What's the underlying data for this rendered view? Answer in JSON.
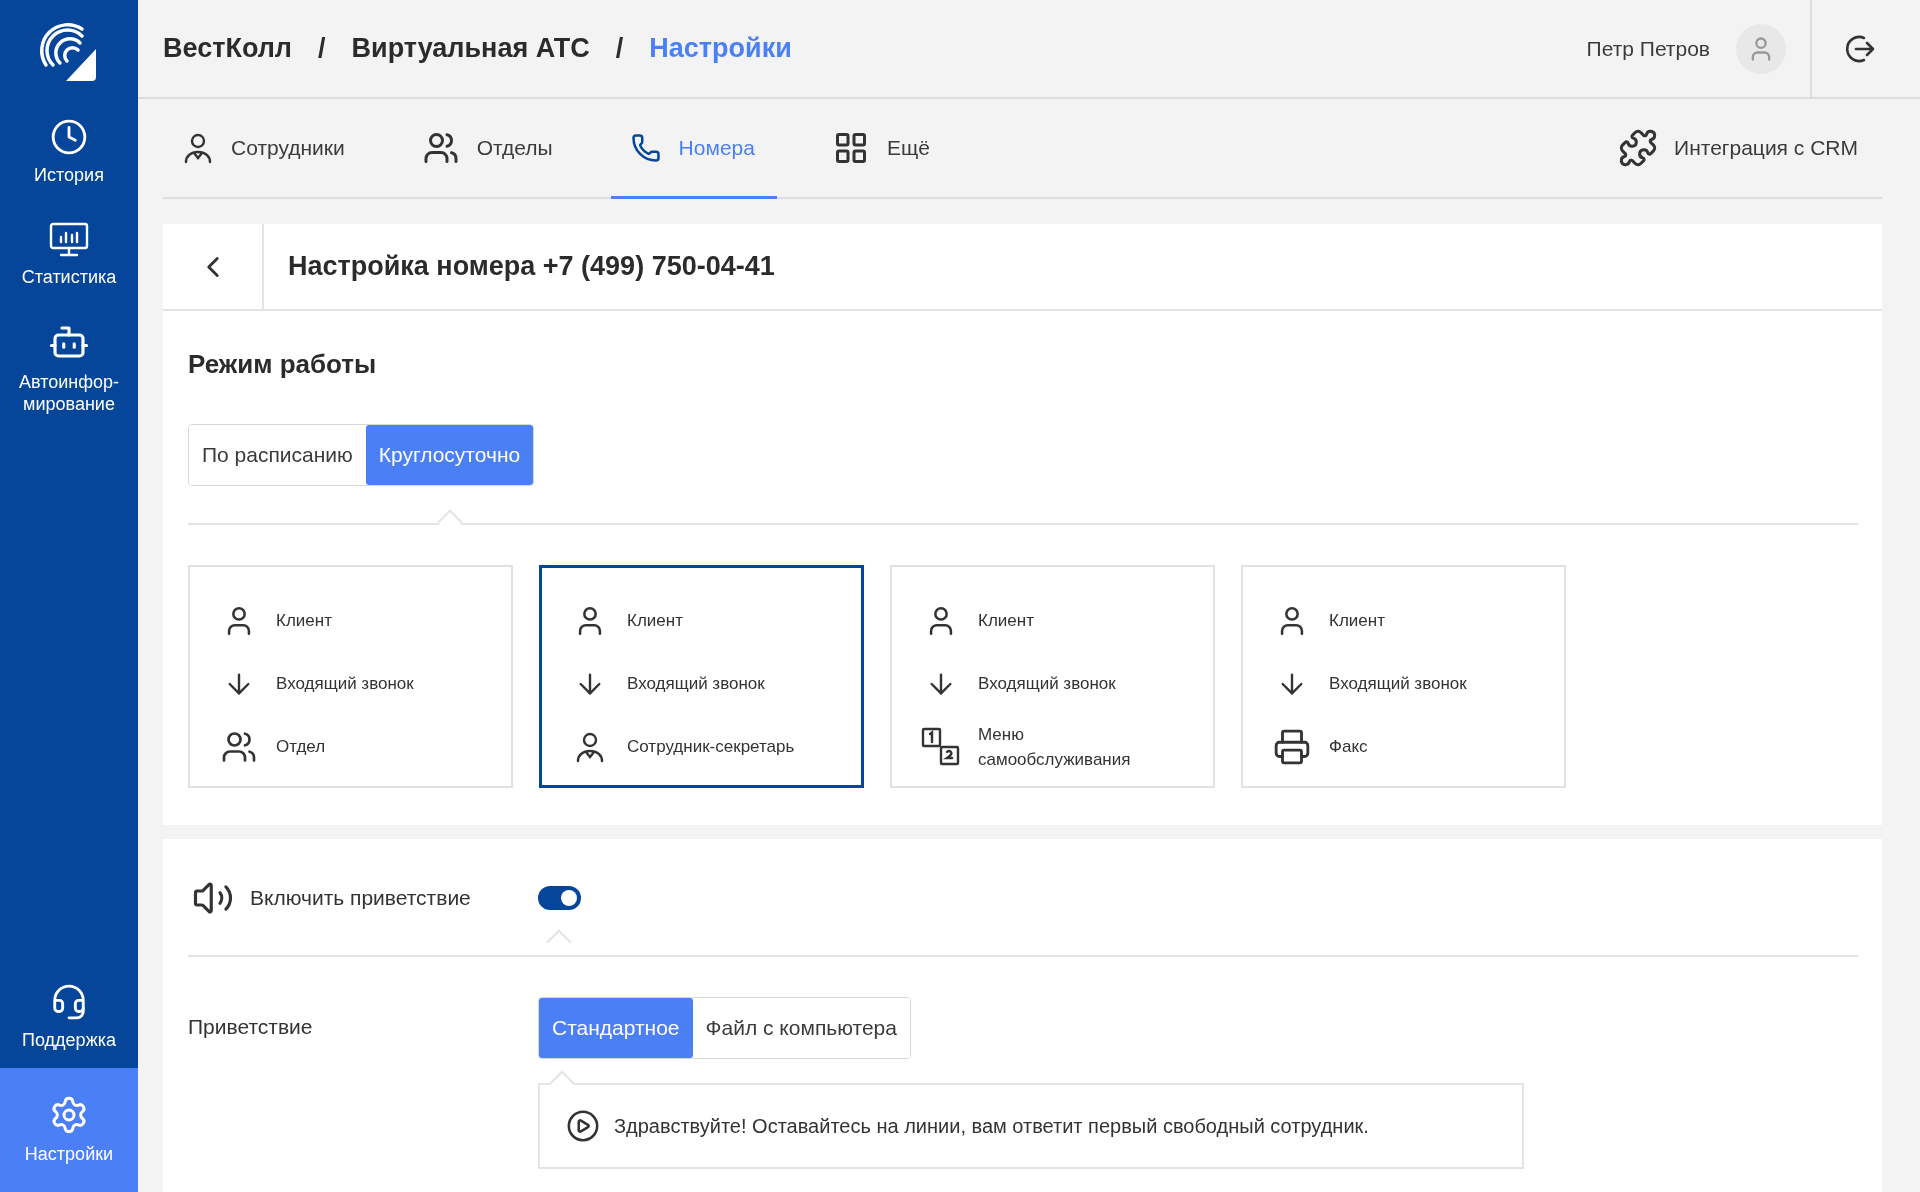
{
  "sidebar": {
    "items": [
      {
        "kind": "history",
        "label": "История",
        "selected": false
      },
      {
        "kind": "stats",
        "label": "Статистика",
        "selected": false
      },
      {
        "kind": "robot",
        "label": "Автоинфор-мирование",
        "selected": false
      }
    ],
    "bottom_items": [
      {
        "kind": "support",
        "label": "Поддержка",
        "selected": false
      },
      {
        "kind": "settings",
        "label": "Настройки",
        "selected": true
      }
    ]
  },
  "breadcrumbs": [
    {
      "label": "ВестКолл",
      "current": false
    },
    {
      "label": "Виртуальная АТС",
      "current": false
    },
    {
      "label": "Настройки",
      "current": true
    }
  ],
  "breadcrumb_separators": [
    "/",
    "/"
  ],
  "user": {
    "name": "Петр Петров"
  },
  "tabs": [
    {
      "kind": "employee",
      "label": "Сотрудники",
      "selected": false
    },
    {
      "kind": "department",
      "label": "Отделы",
      "selected": false
    },
    {
      "kind": "phone",
      "label": "Номера",
      "selected": true
    },
    {
      "kind": "grid",
      "label": "Ещё",
      "selected": false
    }
  ],
  "integration": {
    "label": "Интеграция с CRM"
  },
  "page_title": "Настройка номера +7 (499) 750-04-41",
  "mode": {
    "heading": "Режим работы",
    "options": [
      {
        "label": "По расписанию",
        "selected": false
      },
      {
        "label": "Круглосуточно",
        "selected": true
      }
    ]
  },
  "scenarios": [
    {
      "selected": false,
      "steps": [
        {
          "kind": "client",
          "label": "Клиент"
        },
        {
          "kind": "incoming",
          "label": "Входящий звонок"
        },
        {
          "kind": "department",
          "label": "Отдел"
        }
      ]
    },
    {
      "selected": true,
      "steps": [
        {
          "kind": "client",
          "label": "Клиент"
        },
        {
          "kind": "incoming",
          "label": "Входящий звонок"
        },
        {
          "kind": "employee",
          "label": "Сотрудник-секретарь"
        }
      ]
    },
    {
      "selected": false,
      "steps": [
        {
          "kind": "client",
          "label": "Клиент"
        },
        {
          "kind": "incoming",
          "label": "Входящий звонок"
        },
        {
          "kind": "menu",
          "label": "Меню самообслуживания"
        }
      ]
    },
    {
      "selected": false,
      "steps": [
        {
          "kind": "client",
          "label": "Клиент"
        },
        {
          "kind": "incoming",
          "label": "Входящий звонок"
        },
        {
          "kind": "fax",
          "label": "Факс"
        }
      ]
    }
  ],
  "greeting_toggle": {
    "label": "Включить приветствие",
    "on": true
  },
  "greeting": {
    "label": "Приветствие",
    "options": [
      {
        "label": "Стандартное",
        "selected": true
      },
      {
        "label": "Файл с компьютера",
        "selected": false
      }
    ],
    "message": "Здравствуйте! Оставайтесь на линии, вам ответит первый свободный сотрудник."
  }
}
